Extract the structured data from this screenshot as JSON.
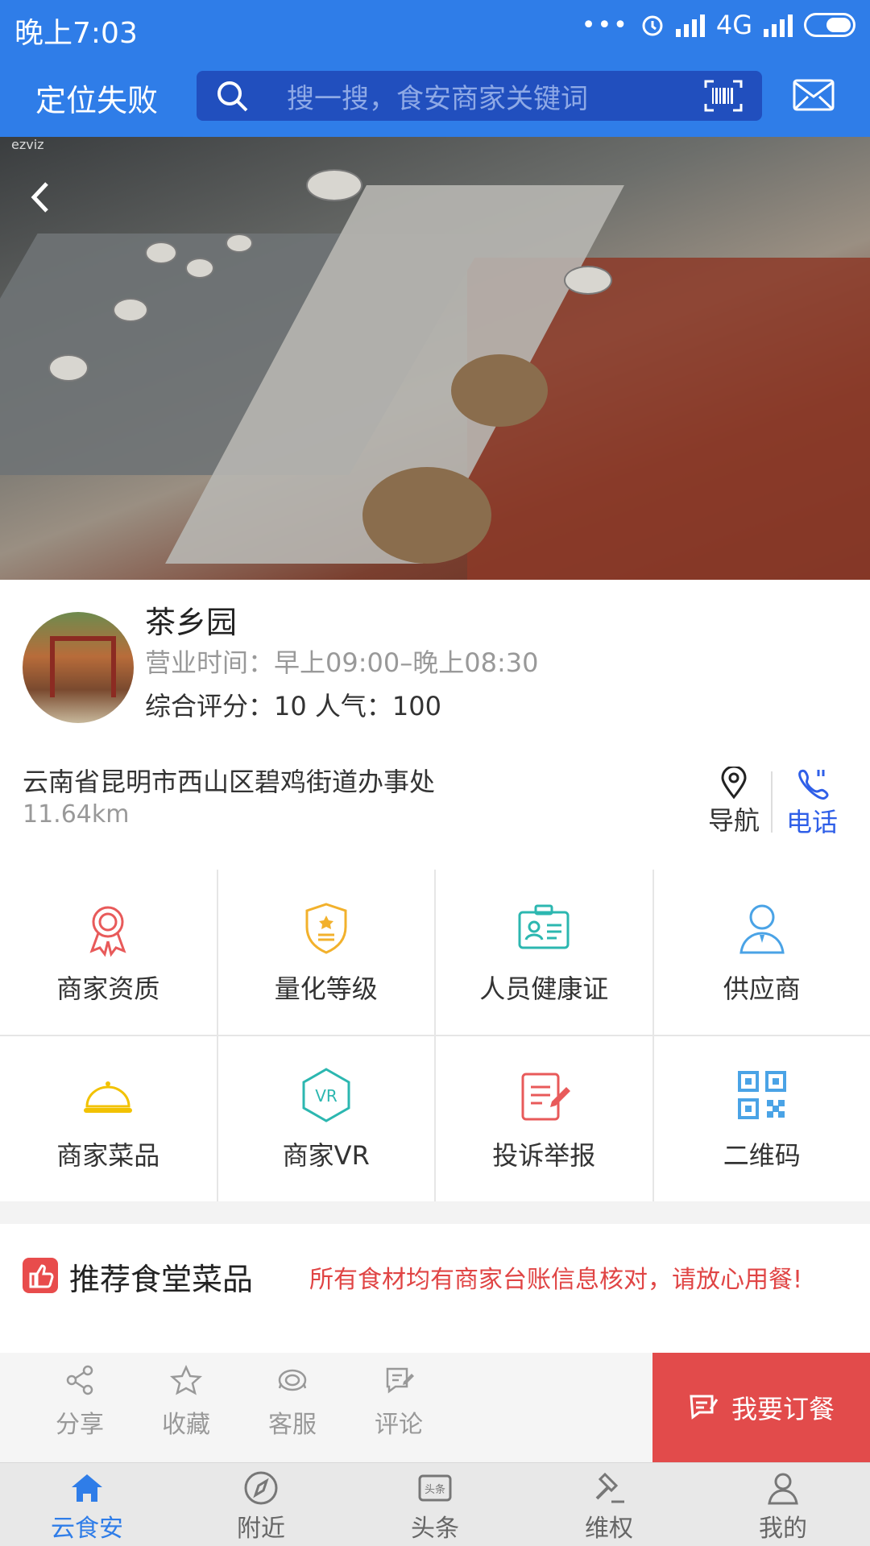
{
  "status_bar": {
    "time": "晚上7:03",
    "network": "4G",
    "dots": "•••"
  },
  "header": {
    "location": "定位失败",
    "search_placeholder": "搜一搜，食安商家关键词"
  },
  "hero": {
    "watermark": "ezviz"
  },
  "shop": {
    "name": "茶乡园",
    "hours": "营业时间：早上09:00–晚上08:30",
    "rating": "综合评分：10   人气：100",
    "address": "云南省昆明市西山区碧鸡街道办事处",
    "distance": "11.64km",
    "nav_label": "导航",
    "call_label": "电话"
  },
  "grid": [
    {
      "label": "商家资质",
      "icon": "award-ribbon-icon",
      "color": "#e85a5a"
    },
    {
      "label": "量化等级",
      "icon": "badge-shield-icon",
      "color": "#f2b12c"
    },
    {
      "label": "人员健康证",
      "icon": "id-card-icon",
      "color": "#2cb7b0"
    },
    {
      "label": "供应商",
      "icon": "person-icon",
      "color": "#4aa3e6"
    },
    {
      "label": "商家菜品",
      "icon": "food-cloche-icon",
      "color": "#f2c200"
    },
    {
      "label": "商家VR",
      "icon": "vr-hexagon-icon",
      "color": "#2cb7b0"
    },
    {
      "label": "投诉举报",
      "icon": "report-form-icon",
      "color": "#e85a5a"
    },
    {
      "label": "二维码",
      "icon": "qr-code-icon",
      "color": "#4aa3e6"
    }
  ],
  "recommend": {
    "title": "推荐食堂菜品",
    "note": "所有食材均有商家台账信息核对，请放心用餐!"
  },
  "actions": {
    "share": "分享",
    "favorite": "收藏",
    "service": "客服",
    "comment": "评论",
    "order": "我要订餐"
  },
  "tabs": [
    {
      "label": "云食安",
      "active": true
    },
    {
      "label": "附近",
      "active": false
    },
    {
      "label": "头条",
      "active": false
    },
    {
      "label": "维权",
      "active": false
    },
    {
      "label": "我的",
      "active": false
    }
  ],
  "tab_icon_text": {
    "headline": "头条"
  },
  "colors": {
    "primary": "#2f7de8",
    "search_bg": "#214fbe",
    "order_red": "#e24b4b",
    "call_blue": "#2f5fe8"
  }
}
